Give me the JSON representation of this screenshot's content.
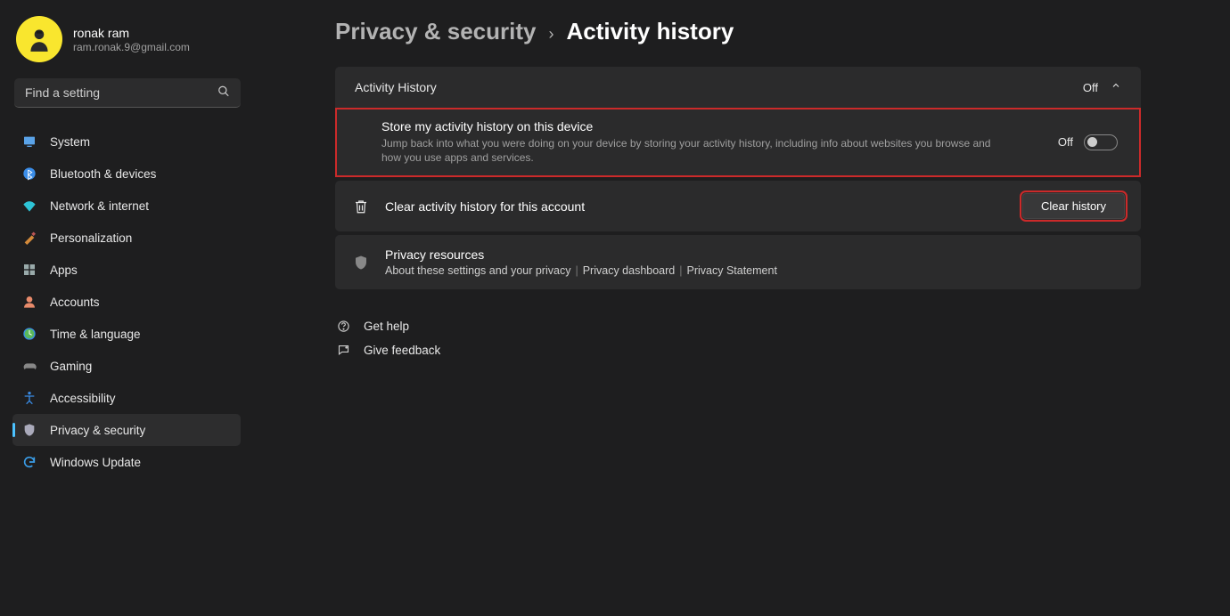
{
  "user": {
    "name": "ronak ram",
    "email": "ram.ronak.9@gmail.com"
  },
  "search": {
    "placeholder": "Find a setting"
  },
  "sidebar": {
    "items": [
      {
        "label": "System",
        "icon": "system"
      },
      {
        "label": "Bluetooth & devices",
        "icon": "bluetooth"
      },
      {
        "label": "Network & internet",
        "icon": "network"
      },
      {
        "label": "Personalization",
        "icon": "personalization"
      },
      {
        "label": "Apps",
        "icon": "apps"
      },
      {
        "label": "Accounts",
        "icon": "accounts"
      },
      {
        "label": "Time & language",
        "icon": "time"
      },
      {
        "label": "Gaming",
        "icon": "gaming"
      },
      {
        "label": "Accessibility",
        "icon": "accessibility"
      },
      {
        "label": "Privacy & security",
        "icon": "privacy",
        "active": true
      },
      {
        "label": "Windows Update",
        "icon": "update"
      }
    ]
  },
  "breadcrumb": {
    "parent": "Privacy & security",
    "current": "Activity history"
  },
  "main": {
    "card_title": "Activity History",
    "card_state": "Off",
    "store": {
      "title": "Store my activity history on this device",
      "desc": "Jump back into what you were doing on your device by storing your activity history, including info about websites you browse and how you use apps and services.",
      "state": "Off"
    },
    "clear": {
      "title": "Clear activity history for this account",
      "button": "Clear history"
    },
    "resources": {
      "title": "Privacy resources",
      "link1": "About these settings and your privacy",
      "link2": "Privacy dashboard",
      "link3": "Privacy Statement"
    }
  },
  "footer": {
    "help": "Get help",
    "feedback": "Give feedback"
  }
}
